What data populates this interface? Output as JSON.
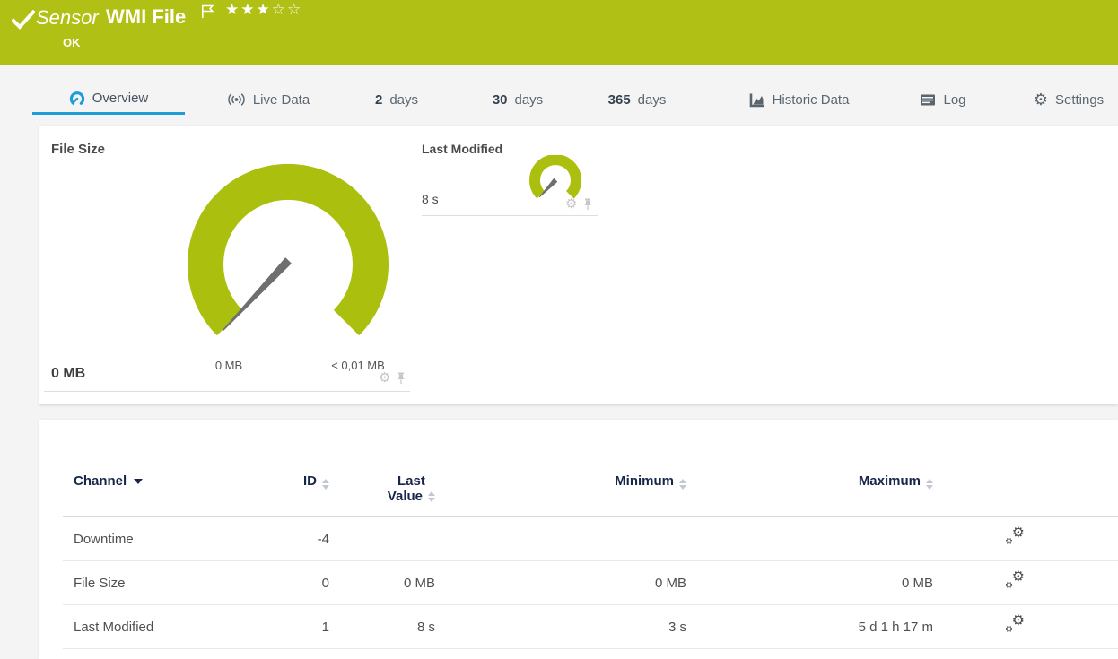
{
  "header": {
    "type_label": "Sensor",
    "title": "WMI File",
    "status": "OK",
    "rating_filled": "★★★",
    "rating_empty": "☆☆"
  },
  "tabs": {
    "overview": "Overview",
    "live_data": "Live Data",
    "days2_num": "2",
    "days2_label": "days",
    "days30_num": "30",
    "days30_label": "days",
    "days365_num": "365",
    "days365_label": "days",
    "historic": "Historic Data",
    "log": "Log",
    "settings": "Settings"
  },
  "gauges": {
    "file_size": {
      "title": "File Size",
      "current_value": "0 MB",
      "scale_min": "0 MB",
      "scale_max": "< 0,01 MB",
      "needle_position": "minimum"
    },
    "last_modified": {
      "title": "Last Modified",
      "current_value": "8 s",
      "needle_position": "minimum"
    }
  },
  "channel_table": {
    "columns": {
      "channel": "Channel",
      "id": "ID",
      "last_value_l1": "Last",
      "last_value_l2": "Value",
      "minimum": "Minimum",
      "maximum": "Maximum"
    },
    "rows": [
      {
        "channel": "Downtime",
        "id": "-4",
        "last_value": "",
        "minimum": "",
        "maximum": ""
      },
      {
        "channel": "File Size",
        "id": "0",
        "last_value": "0 MB",
        "minimum": "0 MB",
        "maximum": "0 MB"
      },
      {
        "channel": "Last Modified",
        "id": "1",
        "last_value": "8 s",
        "minimum": "3 s",
        "maximum": "5 d 1 h 17 m"
      }
    ]
  },
  "colors": {
    "header_green": "#b1c015",
    "gauge_green": "#abc00e",
    "accent_blue": "#1e9cd8",
    "table_header_navy": "#17254a"
  }
}
